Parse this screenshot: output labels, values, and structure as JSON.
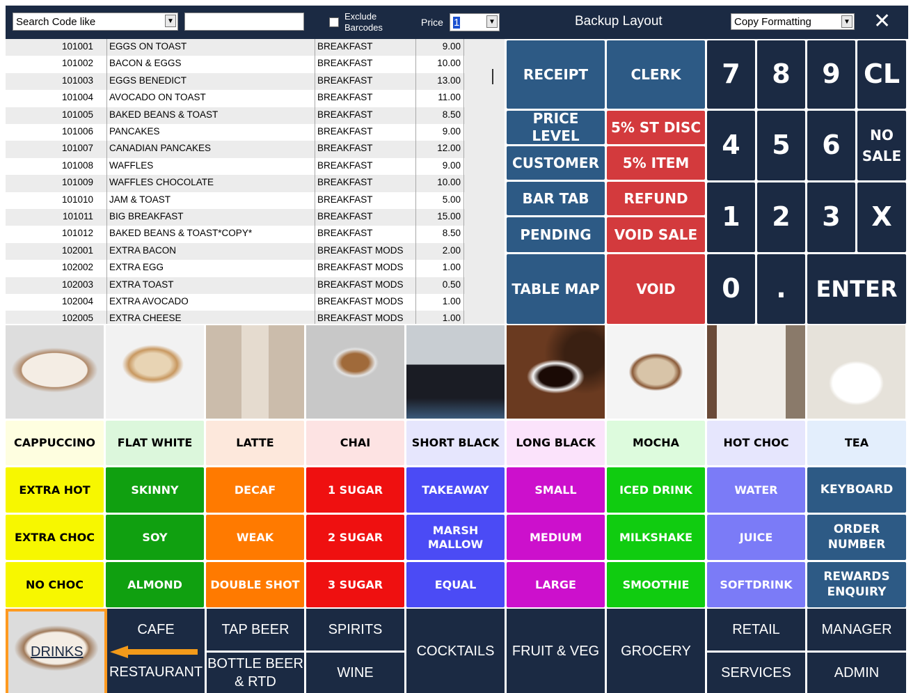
{
  "toolbar": {
    "search_mode": "Search Code like",
    "search_value": "",
    "exclude_barcodes_label": "Exclude Barcodes",
    "price_label": "Price",
    "price_value": "1",
    "layout_title": "Backup Layout",
    "copy_formatting": "Copy Formatting",
    "close_glyph": "✕"
  },
  "items": [
    {
      "code": "101001",
      "name": "EGGS ON TOAST",
      "group": "BREAKFAST",
      "price": "9.00"
    },
    {
      "code": "101002",
      "name": "BACON & EGGS",
      "group": "BREAKFAST",
      "price": "10.00"
    },
    {
      "code": "101003",
      "name": "EGGS BENEDICT",
      "group": "BREAKFAST",
      "price": "13.00"
    },
    {
      "code": "101004",
      "name": "AVOCADO ON TOAST",
      "group": "BREAKFAST",
      "price": "11.00"
    },
    {
      "code": "101005",
      "name": "BAKED BEANS & TOAST",
      "group": "BREAKFAST",
      "price": "8.50"
    },
    {
      "code": "101006",
      "name": "PANCAKES",
      "group": "BREAKFAST",
      "price": "9.00"
    },
    {
      "code": "101007",
      "name": "CANADIAN PANCAKES",
      "group": "BREAKFAST",
      "price": "12.00"
    },
    {
      "code": "101008",
      "name": "WAFFLES",
      "group": "BREAKFAST",
      "price": "9.00"
    },
    {
      "code": "101009",
      "name": "WAFFLES CHOCOLATE",
      "group": "BREAKFAST",
      "price": "10.00"
    },
    {
      "code": "101010",
      "name": "JAM & TOAST",
      "group": "BREAKFAST",
      "price": "5.00"
    },
    {
      "code": "101011",
      "name": "BIG BREAKFAST",
      "group": "BREAKFAST",
      "price": "15.00"
    },
    {
      "code": "101012",
      "name": "BAKED BEANS & TOAST*COPY*",
      "group": "BREAKFAST",
      "price": "8.50"
    },
    {
      "code": "102001",
      "name": "EXTRA BACON",
      "group": "BREAKFAST MODS",
      "price": "2.00"
    },
    {
      "code": "102002",
      "name": "EXTRA EGG",
      "group": "BREAKFAST MODS",
      "price": "1.00"
    },
    {
      "code": "102003",
      "name": "EXTRA TOAST",
      "group": "BREAKFAST MODS",
      "price": "0.50"
    },
    {
      "code": "102004",
      "name": "EXTRA AVOCADO",
      "group": "BREAKFAST MODS",
      "price": "1.00"
    },
    {
      "code": "102005",
      "name": "EXTRA CHEESE",
      "group": "BREAKFAST MODS",
      "price": "1.00"
    }
  ],
  "functions": {
    "receipt": "RECEIPT",
    "clerk": "CLERK",
    "price_level": "PRICE LEVEL",
    "st_disc": "5% ST DISC",
    "customer": "CUSTOMER",
    "item_disc": "5% ITEM",
    "bar_tab": "BAR TAB",
    "refund": "REFUND",
    "pending": "PENDING",
    "void_sale": "VOID SALE",
    "table_map": "TABLE MAP",
    "void": "VOID"
  },
  "keypad": {
    "k7": "7",
    "k8": "8",
    "k9": "9",
    "cl": "CL",
    "k4": "4",
    "k5": "5",
    "k6": "6",
    "no_sale": "NO\nSALE",
    "k1": "1",
    "k2": "2",
    "k3": "3",
    "x": "X",
    "k0": "0",
    "dot": ".",
    "enter": "ENTER"
  },
  "drinks": [
    "CAPPUCCINO",
    "FLAT WHITE",
    "LATTE",
    "CHAI",
    "SHORT BLACK",
    "LONG  BLACK",
    "MOCHA",
    "HOT CHOC",
    "TEA"
  ],
  "drink_colors": [
    "#fefee0",
    "#dcf7dc",
    "#fde8dc",
    "#fde3e3",
    "#e6e6fd",
    "#fbe3fb",
    "#ddfbdd",
    "#e6e6fd",
    "#e3eefc"
  ],
  "modifiers": [
    [
      "EXTRA HOT",
      "SKINNY",
      "DECAF",
      "1 SUGAR",
      "TAKEAWAY",
      "SMALL",
      "ICED DRINK",
      "WATER",
      "KEYBOARD"
    ],
    [
      "EXTRA CHOC",
      "SOY",
      "WEAK",
      "2 SUGAR",
      "MARSH\nMALLOW",
      "MEDIUM",
      "MILKSHAKE",
      "JUICE",
      "ORDER\nNUMBER"
    ],
    [
      "NO CHOC",
      "ALMOND",
      "DOUBLE SHOT",
      "3 SUGAR",
      "EQUAL",
      "LARGE",
      "SMOOTHIE",
      "SOFTDRINK",
      "REWARDS\nENQUIRY"
    ]
  ],
  "modifier_colors": [
    "#f7f700",
    "#10a010",
    "#ff7a00",
    "#ef1010",
    "#4b4bf5",
    "#cc10cc",
    "#10cc10",
    "#7b7bf7",
    "#2d5a85"
  ],
  "modifier_text_colors": [
    "#000000",
    "#ffffff",
    "#ffffff",
    "#ffffff",
    "#ffffff",
    "#ffffff",
    "#ffffff",
    "#ffffff",
    "#ffffff"
  ],
  "nav": {
    "drinks": "DRINKS",
    "cafe": "CAFE",
    "restaurant": "RESTAURANT",
    "tap_beer": "TAP BEER",
    "bottle_beer": "BOTTLE BEER\n& RTD",
    "spirits": "SPIRITS",
    "wine": "WINE",
    "cocktails": "COCKTAILS",
    "fruit_veg": "FRUIT & VEG",
    "grocery": "GROCERY",
    "retail": "RETAIL",
    "services": "SERVICES",
    "manager": "MANAGER",
    "admin": "ADMIN"
  }
}
